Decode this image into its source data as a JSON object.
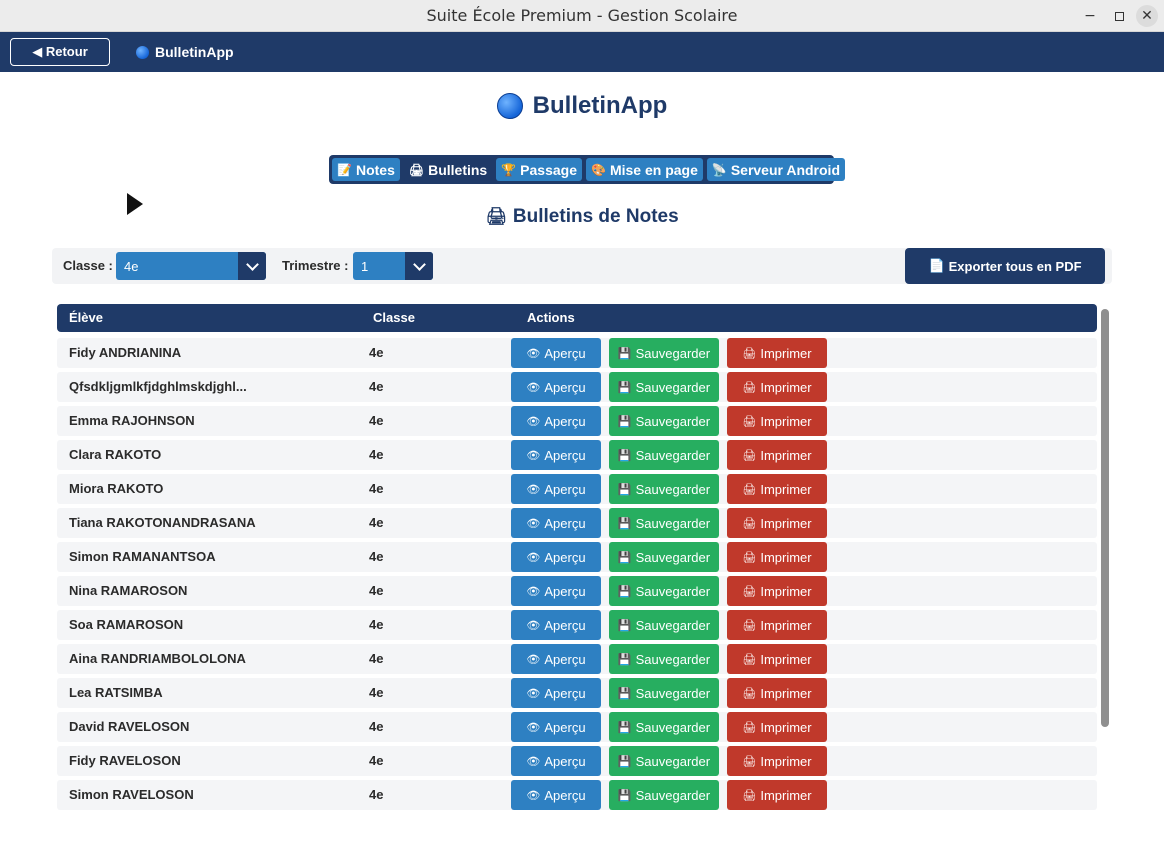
{
  "window": {
    "title": "Suite École Premium - Gestion Scolaire",
    "minimize_glyph": "−",
    "close_glyph": "✕"
  },
  "navbar": {
    "back_label": "◀ Retour",
    "app_name": "BulletinApp"
  },
  "header": {
    "title": "BulletinApp"
  },
  "tabs": [
    {
      "icon": "📝",
      "label": "Notes",
      "active": false
    },
    {
      "icon": "🖨",
      "label": "Bulletins",
      "active": true
    },
    {
      "icon": "🏆",
      "label": "Passage",
      "active": false
    },
    {
      "icon": "🎨",
      "label": "Mise en page",
      "active": false
    },
    {
      "icon": "📡",
      "label": "Serveur Android",
      "active": false
    }
  ],
  "section": {
    "icon": "🖨",
    "title": "Bulletins de Notes"
  },
  "filters": {
    "class_label": "Classe :",
    "class_value": "4e",
    "term_label": "Trimestre :",
    "term_value": "1",
    "export_icon": "📄",
    "export_label": "Exporter tous en PDF"
  },
  "table": {
    "headers": {
      "student": "Élève",
      "class": "Classe",
      "actions": "Actions"
    },
    "actions": {
      "view_icon": "👁",
      "view": "Aperçu",
      "save_icon": "💾",
      "save": "Sauvegarder",
      "print_icon": "🖨",
      "print": "Imprimer"
    },
    "rows": [
      {
        "name": "Fidy ANDRIANINA",
        "class": "4e"
      },
      {
        "name": "Qfsdkljgmlkfjdghlmskdjghl...",
        "class": "4e"
      },
      {
        "name": "Emma RAJOHNSON",
        "class": "4e"
      },
      {
        "name": "Clara RAKOTO",
        "class": "4e"
      },
      {
        "name": "Miora RAKOTO",
        "class": "4e"
      },
      {
        "name": "Tiana RAKOTONANDRASANA",
        "class": "4e"
      },
      {
        "name": "Simon RAMANANTSOA",
        "class": "4e"
      },
      {
        "name": "Nina RAMAROSON",
        "class": "4e"
      },
      {
        "name": "Soa RAMAROSON",
        "class": "4e"
      },
      {
        "name": "Aina RANDRIAMBOLOLONA",
        "class": "4e"
      },
      {
        "name": "Lea RATSIMBA",
        "class": "4e"
      },
      {
        "name": "David RAVELOSON",
        "class": "4e"
      },
      {
        "name": "Fidy RAVELOSON",
        "class": "4e"
      },
      {
        "name": "Simon RAVELOSON",
        "class": "4e"
      }
    ]
  },
  "colors": {
    "navy": "#1f3a68",
    "blue": "#2e80c2",
    "green": "#27ae60",
    "red": "#c0392b"
  }
}
